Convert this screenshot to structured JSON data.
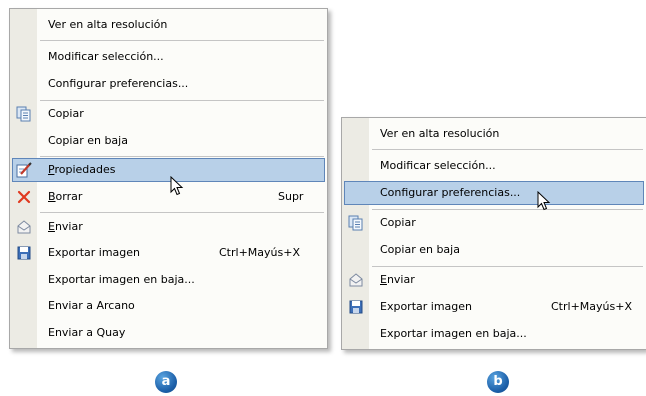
{
  "menu_a": {
    "items": [
      {
        "label": "Ver en alta resolución"
      },
      {
        "label": "Modificar selección..."
      },
      {
        "label": "Configurar preferencias..."
      },
      {
        "label": "Copiar"
      },
      {
        "label": "Copiar en baja"
      },
      {
        "label": "Propiedades",
        "accel": "P",
        "rest": "ropiedades"
      },
      {
        "label": "Borrar",
        "accel": "B",
        "rest": "orrar",
        "shortcut": "Supr"
      },
      {
        "label": "Enviar",
        "accel": "E",
        "rest": "nviar"
      },
      {
        "label": "Exportar imagen",
        "shortcut": "Ctrl+Mayús+X"
      },
      {
        "label": "Exportar imagen en baja..."
      },
      {
        "label": "Enviar a Arcano"
      },
      {
        "label": "Enviar a Quay"
      }
    ]
  },
  "menu_b": {
    "items": [
      {
        "label": "Ver en alta resolución"
      },
      {
        "label": "Modificar selección..."
      },
      {
        "label": "Configurar preferencias..."
      },
      {
        "label": "Copiar"
      },
      {
        "label": "Copiar en baja"
      },
      {
        "label": "Enviar",
        "accel": "E",
        "rest": "nviar"
      },
      {
        "label": "Exportar imagen",
        "shortcut": "Ctrl+Mayús+X"
      },
      {
        "label": "Exportar imagen en baja..."
      }
    ]
  },
  "badges": {
    "a": "a",
    "b": "b"
  },
  "icons": [
    "copy-icon",
    "properties-icon",
    "delete-icon",
    "send-mail-icon",
    "save-icon"
  ],
  "colors": {
    "highlight_fill": "#b8d0e8",
    "highlight_border": "#5f86b9",
    "gutter": "#ecebe4",
    "badge": "#1c5fa8",
    "delete_icon": "#e0391f"
  }
}
